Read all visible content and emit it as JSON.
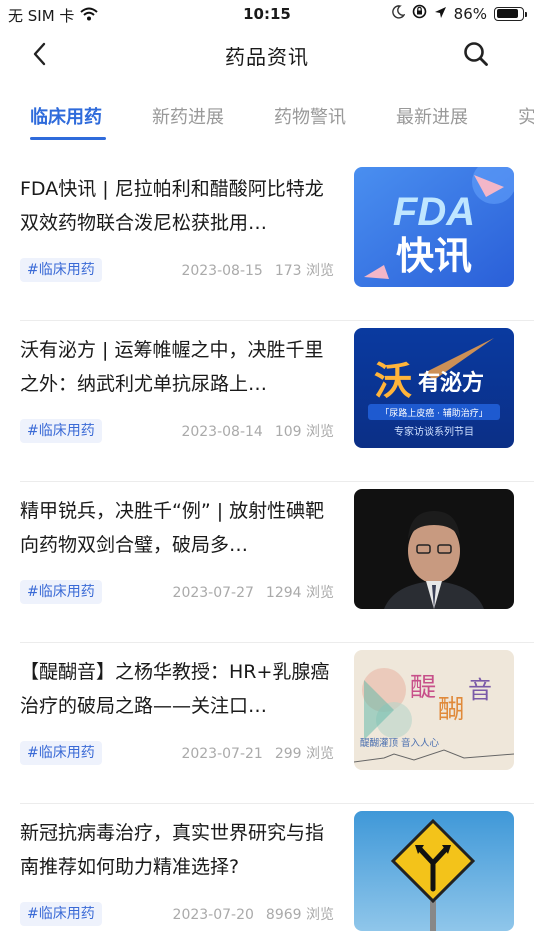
{
  "status": {
    "carrier": "无 SIM 卡",
    "time": "10:15",
    "battery": "86%",
    "battery_level": 0.86
  },
  "header": {
    "title": "药品资讯",
    "back_icon": "chevron-left-icon",
    "search_icon": "search-icon"
  },
  "tabs": [
    {
      "label": "临床用药",
      "active": true
    },
    {
      "label": "新药进展",
      "active": false
    },
    {
      "label": "药物警讯",
      "active": false
    },
    {
      "label": "最新进展",
      "active": false
    },
    {
      "label": "实",
      "active": false
    }
  ],
  "accent_color": "#2f6bdb",
  "articles": [
    {
      "title": "FDA快讯 | 尼拉帕利和醋酸阿比特龙双效药物联合泼尼松获批用…",
      "tag": "#临床用药",
      "date": "2023-08-15",
      "views": "173 浏览",
      "thumb": {
        "line1": "FDA",
        "line2": "快讯"
      }
    },
    {
      "title": "沃有泌方 | 运筹帷幄之中，决胜千里之外：纳武利尤单抗尿路上…",
      "tag": "#临床用药",
      "date": "2023-08-14",
      "views": "109 浏览",
      "thumb": {
        "line1": "沃",
        "line2": "有泌方",
        "line3": "「尿路上皮癌 · 辅助治疗」",
        "line4": "专家访谈系列节目"
      }
    },
    {
      "title": "精甲锐兵，决胜千“例” |  放射性碘靶向药物双剑合璧，破局多…",
      "tag": "#临床用药",
      "date": "2023-07-27",
      "views": "1294 浏览",
      "thumb": {}
    },
    {
      "title": "【醍醐音】之杨华教授：HR+乳腺癌治疗的破局之路——关注口…",
      "tag": "#临床用药",
      "date": "2023-07-21",
      "views": "299 浏览",
      "thumb": {
        "line1": "醍",
        "line2": "醐",
        "line3": "音",
        "line4": "醍醐灌顶  音入人心"
      }
    },
    {
      "title": "新冠抗病毒治疗，真实世界研究与指南推荐如何助力精准选择?",
      "tag": "#临床用药",
      "date": "2023-07-20",
      "views": "8969 浏览",
      "thumb": {}
    }
  ]
}
